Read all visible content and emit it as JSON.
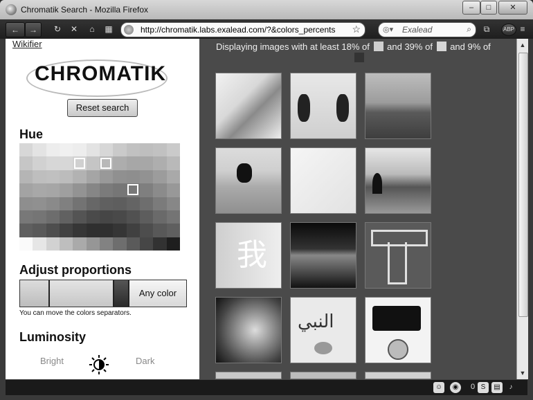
{
  "window": {
    "title": "Chromatik Search - Mozilla Firefox",
    "minimize": "–",
    "maximize": "□",
    "close": "✕"
  },
  "toolbar": {
    "back": "←",
    "forward": "→",
    "reload": "↻",
    "stop": "✕",
    "home": "⌂",
    "url": "http://chromatik.labs.exalead.com/?&colors_percents",
    "search_placeholder": "Exalead",
    "abp": "ABP",
    "bookmark_star": "☆"
  },
  "sidebar": {
    "wikifier": "Wikifier",
    "logo_text": "CHROMATIK",
    "reset_button": "Reset search",
    "hue_heading": "Hue",
    "adjust_heading": "Adjust proportions",
    "any_color": "Any color",
    "hint": "You can move the colors separators.",
    "luminosity_heading": "Luminosity",
    "bright": "Bright",
    "dark": "Dark"
  },
  "results": {
    "prefix": "Displaying images with at least",
    "p1": "18%",
    "of1": "of",
    "and1": "and",
    "p2": "39%",
    "of2": "of",
    "and2": "and",
    "p3": "9%",
    "of3": "of",
    "swatch_colors": [
      "#cfcfcf",
      "#d6d6d6",
      "#333333"
    ]
  },
  "statusbar": {
    "count": "0"
  }
}
